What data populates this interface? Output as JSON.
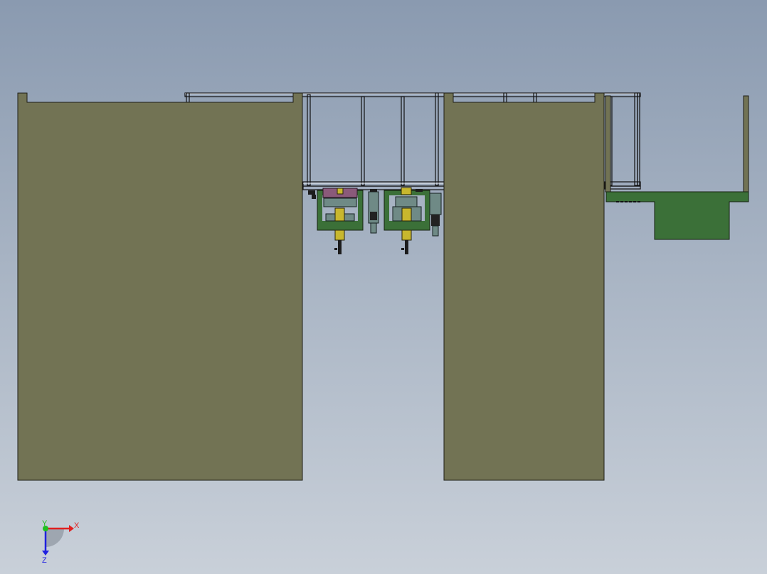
{
  "viewport": {
    "background_top": "#8a9ab0",
    "background_bottom": "#c9d0d9"
  },
  "model_colors": {
    "cabinet": "#727354",
    "bracket": "#3b7038",
    "cylinder": "#c8b72e",
    "block": "#6f8a86",
    "pad": "#8a5a7a"
  },
  "triad": {
    "icon": "coordinate-triad-icon",
    "x_label": "X",
    "y_label": "Y",
    "z_label": "Z",
    "x_color": "#e02020",
    "y_color": "#20c020",
    "z_color": "#2020e0"
  }
}
